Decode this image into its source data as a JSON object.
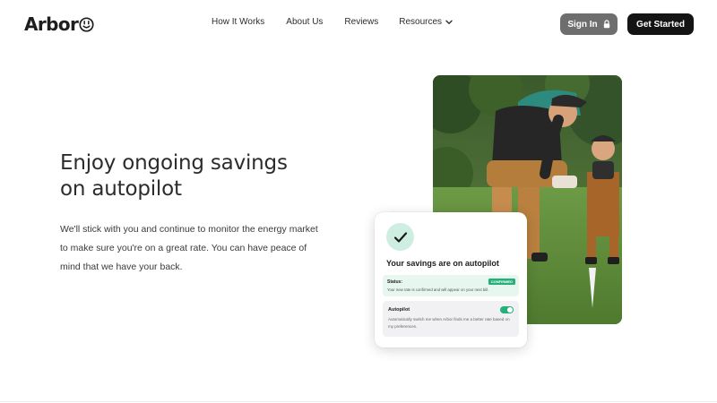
{
  "brand": {
    "name": "Arbor"
  },
  "nav": {
    "items": [
      "How It Works",
      "About Us",
      "Reviews"
    ],
    "resources_label": "Resources"
  },
  "header_buttons": {
    "sign_in": "Sign In",
    "get_started": "Get Started"
  },
  "hero": {
    "headline_line1": "Enjoy ongoing savings",
    "headline_line2": "on autopilot",
    "body": "We'll stick with you and continue to monitor the energy market to make sure you're on a great rate. You can have peace of mind that we have your back."
  },
  "card": {
    "title": "Your savings are on autopilot",
    "status": {
      "label": "Status:",
      "badge": "CONFIRMED",
      "note": "Your new rate is confirmed and will appear on your next bill."
    },
    "autopilot": {
      "label": "Autopilot",
      "toggle_on": true,
      "description": "Automatically switch me when Arbor finds me a better rate based on my preferences."
    }
  },
  "colors": {
    "accent_green": "#25b07a",
    "mint": "#cfeee2",
    "dark_button": "#141414",
    "gray_button": "#6e6e6e"
  },
  "icons": [
    "smile-icon",
    "chevron-down-icon",
    "lock-icon",
    "check-icon"
  ]
}
